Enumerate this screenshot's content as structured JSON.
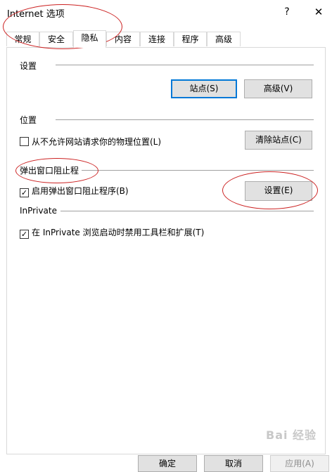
{
  "window": {
    "title": "Internet 选项",
    "help_glyph": "?",
    "close_glyph": "✕"
  },
  "tabs": [
    {
      "label": "常规"
    },
    {
      "label": "安全"
    },
    {
      "label": "隐私",
      "active": true
    },
    {
      "label": "内容"
    },
    {
      "label": "连接"
    },
    {
      "label": "程序"
    },
    {
      "label": "高级"
    }
  ],
  "settings_group": {
    "label": "设置",
    "sites_button": "站点(S)",
    "advanced_button": "高级(V)"
  },
  "location_group": {
    "label": "位置",
    "checkbox_label": "从不允许网站请求你的物理位置(L)",
    "checked": false,
    "clear_sites_button": "清除站点(C)"
  },
  "popup_group": {
    "label": "弹出窗口阻止程",
    "checkbox_label": "启用弹出窗口阻止程序(B)",
    "checked": true,
    "settings_button": "设置(E)"
  },
  "inprivate_group": {
    "label": "InPrivate",
    "checkbox_label": "在 InPrivate 浏览启动时禁用工具栏和扩展(T)",
    "checked": true
  },
  "footer": {
    "ok_button": "确定",
    "cancel_button": "取消",
    "apply_button": "应用(A)"
  },
  "watermark": "Bai 经验",
  "colors": {
    "default_button_border": "#0078d7",
    "annotation": "#cc2222"
  }
}
